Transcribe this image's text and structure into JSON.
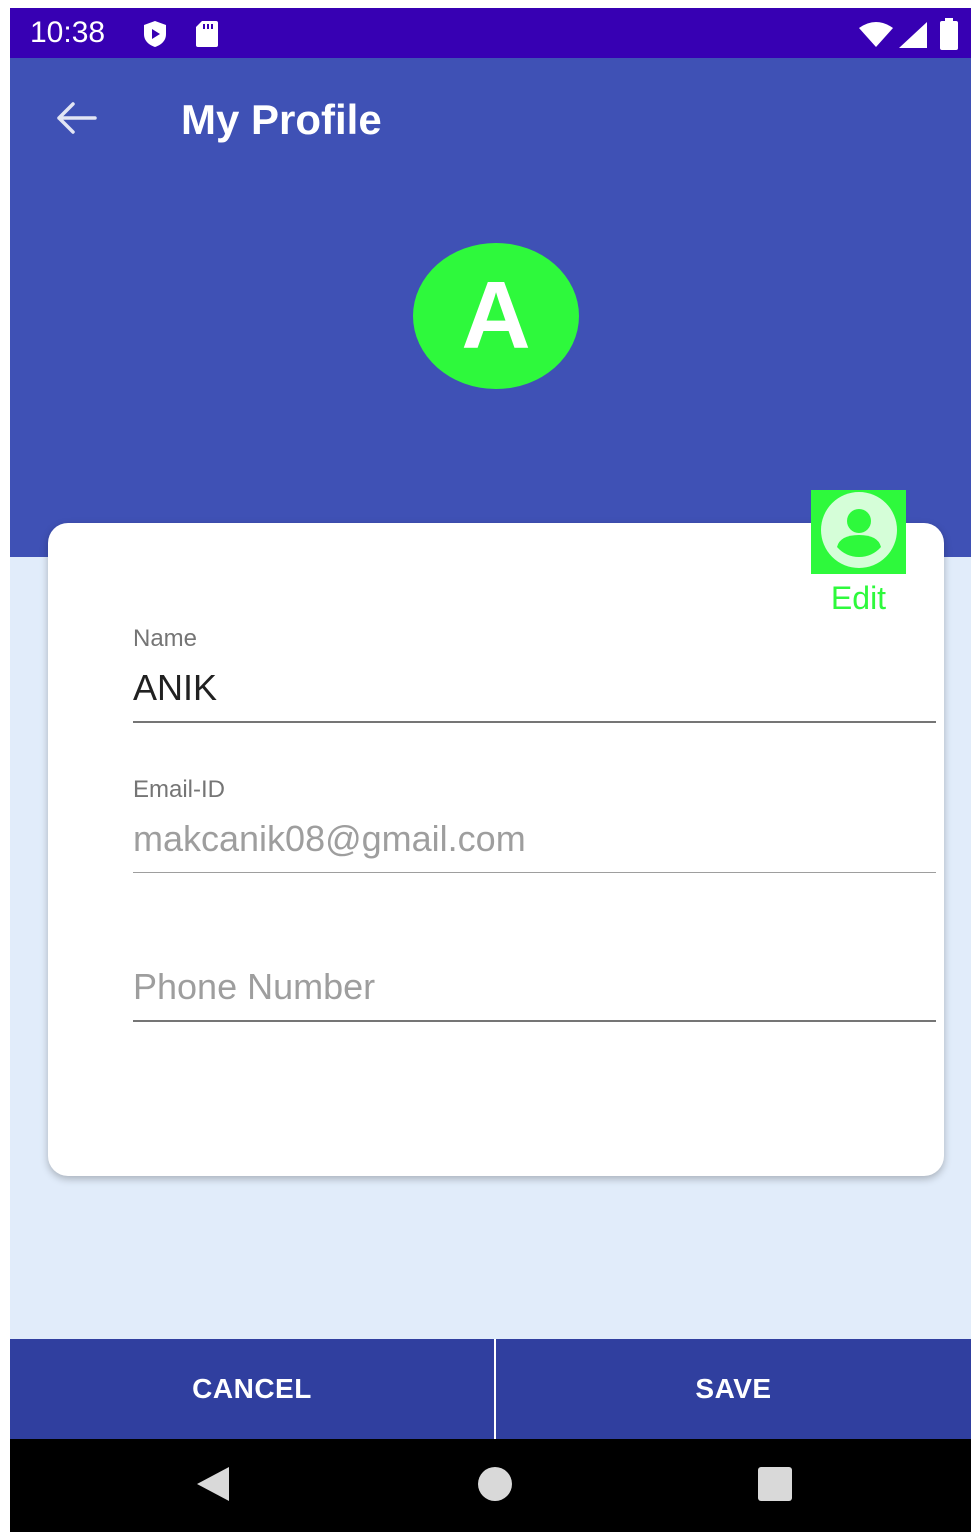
{
  "status_bar": {
    "time": "10:38",
    "icons": [
      "play-protect-icon",
      "sd-card-icon",
      "wifi-icon",
      "cell-signal-icon",
      "battery-icon"
    ]
  },
  "app_bar": {
    "title": "My Profile",
    "back_icon": "arrow-back-icon"
  },
  "avatar": {
    "initial": "A",
    "color": "#2ef93c"
  },
  "edit": {
    "icon": "account-circle-icon",
    "label": "Edit"
  },
  "form": {
    "name": {
      "label": "Name",
      "value": "ANIK"
    },
    "email": {
      "label": "Email-ID",
      "value": "makcanik08@gmail.com"
    },
    "phone": {
      "label": "",
      "value": "",
      "placeholder": "Phone Number"
    }
  },
  "actions": {
    "cancel": "CANCEL",
    "save": "SAVE"
  },
  "nav_bar": {
    "icons": [
      "back-triangle-icon",
      "home-circle-icon",
      "recents-square-icon"
    ]
  },
  "colors": {
    "status_bar": "#3700b3",
    "primary": "#3f51b5",
    "primary_dark": "#303f9f",
    "accent_green": "#2ef93c",
    "background": "#e1ecfa"
  }
}
